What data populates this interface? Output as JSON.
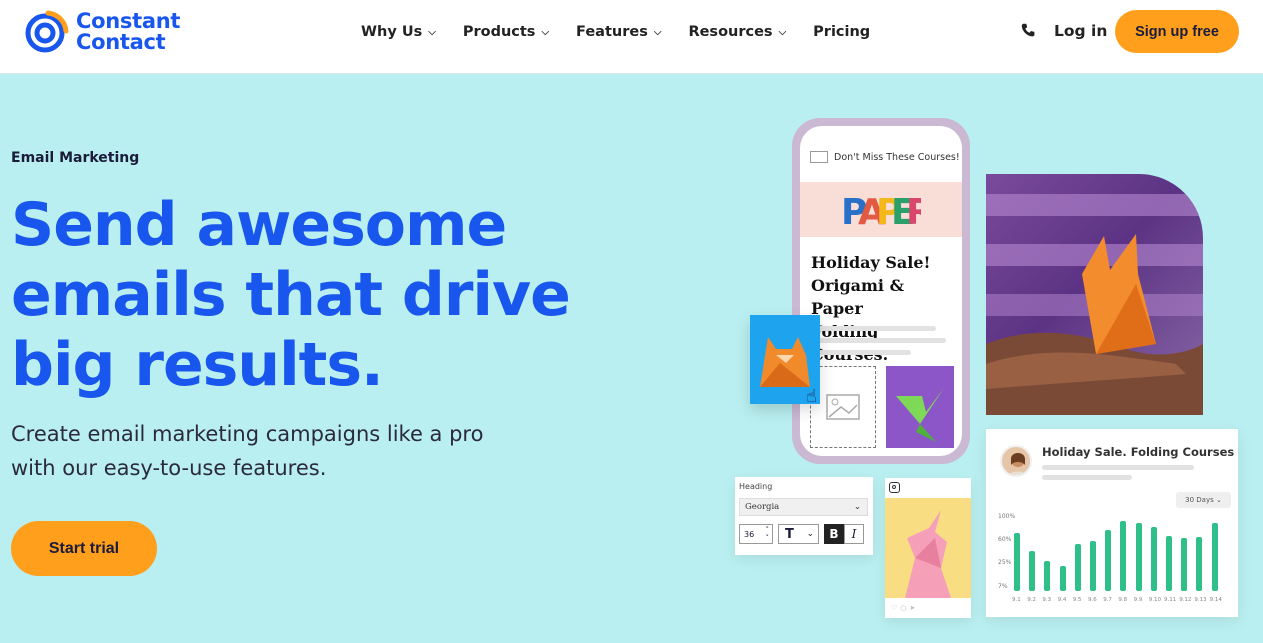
{
  "brand": {
    "name_line1": "Constant",
    "name_line2": "Contact",
    "blue": "#1856ed",
    "orange": "#ff9f1c"
  },
  "nav": {
    "items": [
      {
        "label": "Why Us",
        "has_menu": true
      },
      {
        "label": "Products",
        "has_menu": true
      },
      {
        "label": "Features",
        "has_menu": true
      },
      {
        "label": "Resources",
        "has_menu": true
      },
      {
        "label": "Pricing",
        "has_menu": false
      }
    ],
    "login": "Log in",
    "signup": "Sign up free"
  },
  "hero": {
    "eyebrow": "Email Marketing",
    "headline_lines": [
      "Send awesome",
      "emails that drive",
      "big results."
    ],
    "sub_lines": [
      "Create email marketing campaigns like a pro",
      "with our easy-to-use features."
    ],
    "cta": "Start trial",
    "background": "#b9eff0"
  },
  "phone_mock": {
    "subject": "Don't Miss These Courses!",
    "banner": "PAPER",
    "title_lines": [
      "Holiday Sale!",
      "Origami & Paper",
      "Folding Courses."
    ]
  },
  "stats_card": {
    "title": "Holiday Sale. Folding Courses",
    "range": "30 Days",
    "y_ticks": [
      "100%",
      "60%",
      "25%",
      "7%"
    ],
    "x_ticks": [
      "9.1",
      "9.2",
      "9.3",
      "9.4",
      "9.5",
      "9.6",
      "9.7",
      "9.8",
      "9.9",
      "9.10",
      "9.11",
      "9.12",
      "9.13",
      "9.14"
    ],
    "values": [
      48,
      33,
      25,
      21,
      39,
      42,
      51,
      58,
      57,
      53,
      46,
      44,
      45,
      57
    ]
  },
  "editor_card": {
    "label": "Heading",
    "font": "Georgia",
    "size": "36",
    "bold": "B",
    "italic": "I"
  }
}
